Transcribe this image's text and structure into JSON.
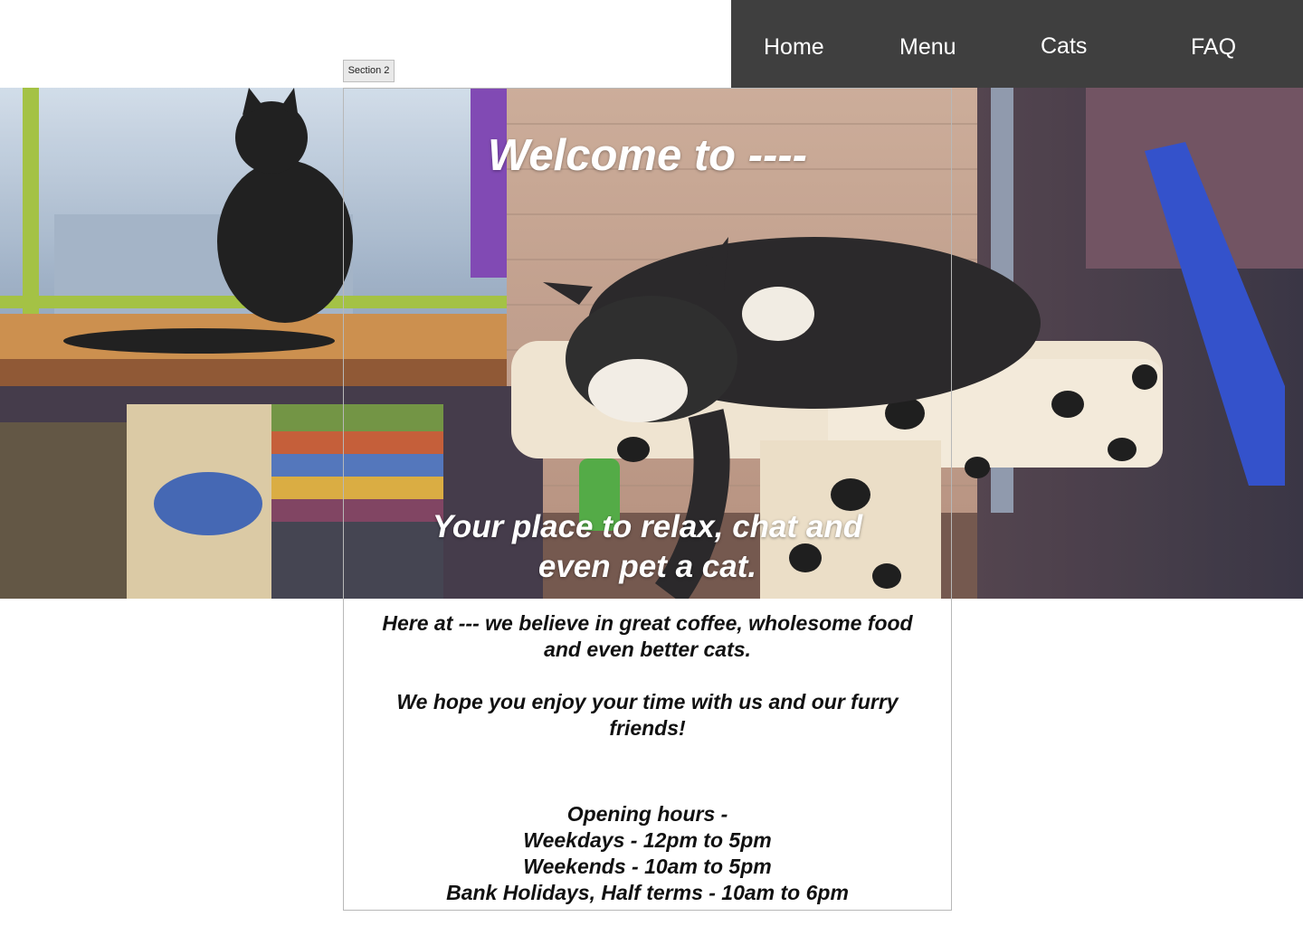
{
  "nav": {
    "items": [
      {
        "label": "Home"
      },
      {
        "label": "Menu"
      },
      {
        "label": "Cats"
      },
      {
        "label": "FAQ"
      }
    ],
    "background": "#3f3f3f"
  },
  "section_label": "Section 2",
  "hero": {
    "title": "Welcome to ----",
    "subtitle_line1": "Your place to relax, chat and",
    "subtitle_line2": "even pet a cat.",
    "image": "cat-cafe-photo"
  },
  "intro": {
    "line1": "Here at --- we believe in great coffee, wholesome food",
    "line2": "and even better cats.",
    "line3": "We hope you enjoy your time with us and our furry",
    "line4": "friends!"
  },
  "hours": {
    "heading": "Opening hours -",
    "weekdays": "Weekdays - 12pm to 5pm",
    "weekends": "Weekends - 10am to 5pm",
    "holidays": "Bank Holidays, Half terms - 10am to 6pm"
  }
}
